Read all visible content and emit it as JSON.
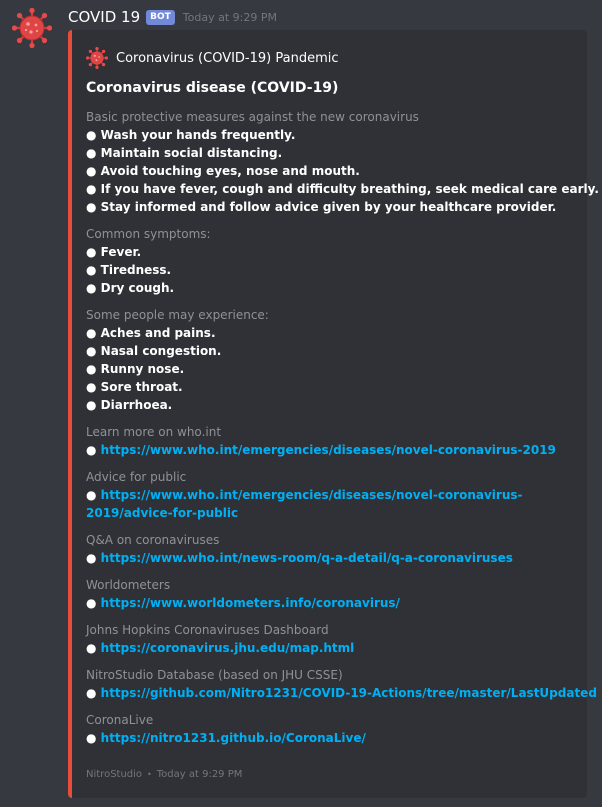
{
  "message": {
    "username": "COVID 19",
    "bot_tag": "BOT",
    "timestamp": "Today at 9:29 PM"
  },
  "embed": {
    "accent_color": "#e74c3c",
    "author": "Coronavirus (COVID-19) Pandemic",
    "title": "Coronavirus disease (COVID-19)",
    "sections": {
      "protective": {
        "label": "Basic protective measures against the new coronavirus",
        "items": [
          "● Wash your hands frequently.",
          "● Maintain social distancing.",
          "● Avoid touching eyes, nose and mouth.",
          "● If you have fever, cough and difficulty breathing, seek medical care early.",
          "● Stay informed and follow advice given by your healthcare provider."
        ]
      },
      "symptoms": {
        "label": "Common symptoms:",
        "items": [
          "● Fever.",
          "● Tiredness.",
          "● Dry cough."
        ]
      },
      "experience": {
        "label": "Some people may experience:",
        "items": [
          "● Aches and pains.",
          "● Nasal congestion.",
          "● Runny nose.",
          "● Sore throat.",
          "● Diarrhoea."
        ]
      },
      "who": {
        "label": "Learn more on who.int",
        "bullet": "● ",
        "link": "https://www.who.int/emergencies/diseases/novel-coronavirus-2019"
      },
      "advice": {
        "label": "Advice for public",
        "bullet": "● ",
        "link": "https://www.who.int/emergencies/diseases/novel-coronavirus-2019/advice-for-public"
      },
      "qa": {
        "label": "Q&A on coronaviruses",
        "bullet": "● ",
        "link": "https://www.who.int/news-room/q-a-detail/q-a-coronaviruses"
      },
      "worldometers": {
        "label": "Worldometers",
        "bullet": "● ",
        "link": "https://www.worldometers.info/coronavirus/"
      },
      "jhu": {
        "label": "Johns Hopkins Coronaviruses Dashboard",
        "bullet": "● ",
        "link": "https://coronavirus.jhu.edu/map.html"
      },
      "nitro": {
        "label": "NitroStudio Database (based on JHU CSSE)",
        "bullet": "● ",
        "link": "https://github.com/Nitro1231/COVID-19-Actions/tree/master/LastUpdated"
      },
      "coronalive": {
        "label": "CoronaLive",
        "bullet": "● ",
        "link": "https://nitro1231.github.io/CoronaLive/"
      }
    },
    "footer": {
      "text": "NitroStudio",
      "separator": "•",
      "timestamp": "Today at 9:29 PM"
    }
  }
}
